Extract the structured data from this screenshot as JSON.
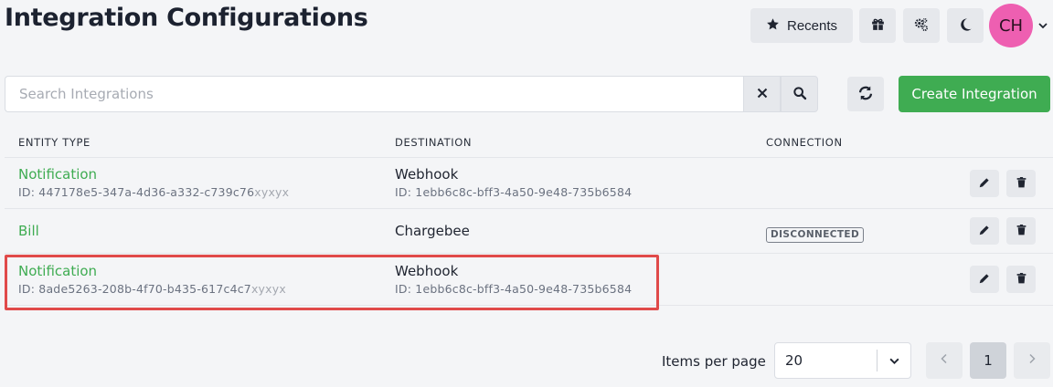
{
  "page": {
    "title": "Integration Configurations"
  },
  "topbar": {
    "recents_label": "Recents",
    "icons": [
      "star-icon",
      "gift-icon",
      "gears-icon",
      "moon-icon",
      "chevron-down-icon"
    ],
    "avatar_initials": "CH",
    "avatar_color": "#ee5fb1"
  },
  "search": {
    "placeholder": "Search Integrations",
    "value": ""
  },
  "actions": {
    "create_label": "Create Integration",
    "accent": "#3fac52"
  },
  "table": {
    "headers": {
      "entity_type": "ENTITY TYPE",
      "destination": "DESTINATION",
      "connection": "CONNECTION"
    },
    "rows": [
      {
        "entity_name": "Notification",
        "entity_id": "ID: 447178e5-347a-4d36-a332-c739c76",
        "entity_id_suffix": "xyxyx",
        "dest_name": "Webhook",
        "dest_id": "ID: 1ebb6c8c-bff3-4a50-9e48-735b6584",
        "connection": ""
      },
      {
        "entity_name": "Bill",
        "entity_id": "",
        "entity_id_suffix": "",
        "dest_name": "Chargebee",
        "dest_id": "",
        "connection": "DISCONNECTED"
      },
      {
        "entity_name": "Notification",
        "entity_id": "ID: 8ade5263-208b-4f70-b435-617c4c7",
        "entity_id_suffix": "xyxyx",
        "dest_name": "Webhook",
        "dest_id": "ID: 1ebb6c8c-bff3-4a50-9e48-735b6584",
        "connection": ""
      }
    ]
  },
  "pagination": {
    "items_per_page_label": "Items per page",
    "items_per_page_value": "20",
    "current_page": "1"
  }
}
